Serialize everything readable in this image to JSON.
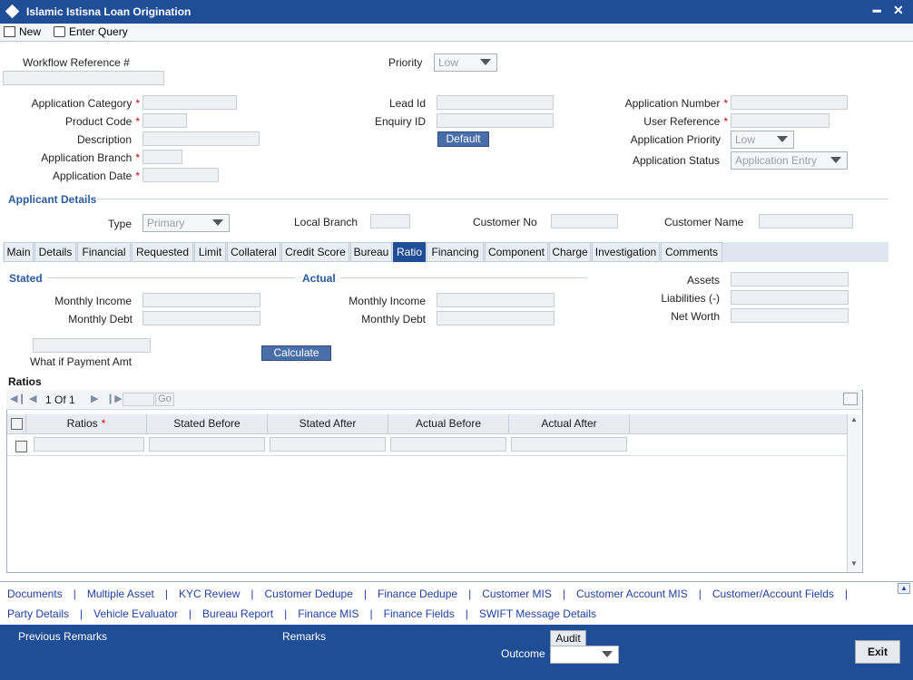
{
  "window": {
    "title": "Islamic Istisna Loan Origination"
  },
  "toolbar": {
    "new_label": "New",
    "enter_query_label": "Enter Query"
  },
  "header": {
    "workflow_ref_label": "Workflow Reference #",
    "priority_label": "Priority",
    "priority_value": "Low",
    "app_category_label": "Application Category",
    "product_code_label": "Product Code",
    "description_label": "Description",
    "app_branch_label": "Application Branch",
    "app_date_label": "Application Date",
    "lead_id_label": "Lead Id",
    "enquiry_id_label": "Enquiry ID",
    "default_button": "Default",
    "app_number_label": "Application Number",
    "user_ref_label": "User Reference",
    "app_priority_label": "Application Priority",
    "app_priority_value": "Low",
    "app_status_label": "Application Status",
    "app_status_value": "Application Entry",
    "required_mark": "*"
  },
  "applicant": {
    "section_title": "Applicant Details",
    "type_label": "Type",
    "type_value": "Primary",
    "local_branch_label": "Local Branch",
    "customer_no_label": "Customer No",
    "customer_name_label": "Customer Name"
  },
  "tabs": [
    "Main",
    "Details",
    "Financial",
    "Requested",
    "Limit",
    "Collateral",
    "Credit Score",
    "Bureau",
    "Ratio",
    "Financing",
    "Component",
    "Charge",
    "Investigation",
    "Comments"
  ],
  "active_tab": "Ratio",
  "ratio": {
    "stated_title": "Stated",
    "actual_title": "Actual",
    "monthly_income_label": "Monthly Income",
    "monthly_debt_label": "Monthly Debt",
    "assets_label": "Assets",
    "liabilities_label": "Liabilities (-)",
    "net_worth_label": "Net Worth",
    "what_if_label": "What if Payment Amt",
    "calculate_button": "Calculate",
    "ratios_title": "Ratios"
  },
  "grid": {
    "page_text": "1 Of 1",
    "go_label": "Go",
    "columns": [
      "Ratios",
      "Stated Before",
      "Stated After",
      "Actual Before",
      "Actual After"
    ]
  },
  "footer_links": {
    "row1": [
      "Documents",
      "Multiple Asset",
      "KYC Review",
      "Customer Dedupe",
      "Finance Dedupe",
      "Customer MIS",
      "Customer Account MIS",
      "Customer/Account Fields"
    ],
    "row2": [
      "Party Details",
      "Vehicle Evaluator",
      "Bureau Report",
      "Finance MIS",
      "Finance Fields",
      "SWIFT Message Details"
    ],
    "separator": "|"
  },
  "bottom": {
    "previous_remarks_label": "Previous Remarks",
    "remarks_label": "Remarks",
    "audit_button": "Audit",
    "outcome_label": "Outcome",
    "exit_button": "Exit"
  },
  "colors": {
    "title_bar": "#1f4e96",
    "link": "#1f3fa0",
    "section_heading": "#2a5b9c",
    "required": "#cc0000"
  }
}
